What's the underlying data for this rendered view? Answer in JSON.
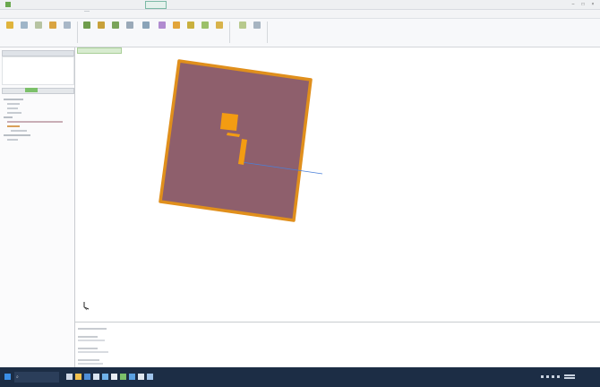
{
  "colors": {
    "substrate_fill": "#8e5f6c",
    "substrate_edge": "#e08f1c",
    "patch": "#f39c12",
    "axis": "#4a7fd8",
    "taskbar": "#1c2d45"
  },
  "icons": {
    "app": "app-logo-icon",
    "ribbon": [
      "toolbar-icon"
    ],
    "taskbar": [
      "windows-start-icon",
      "search-icon",
      "taskbar-app-icon"
    ],
    "viewport_axis": "coordinate-axis-icon"
  },
  "titlebar": {
    "title": ""
  },
  "menubar": {
    "items": [
      "",
      "",
      "",
      "",
      "",
      "",
      "",
      "",
      "",
      "",
      ""
    ]
  },
  "ribbon": {
    "labels": [
      "",
      "",
      "",
      "",
      "",
      "",
      "",
      "",
      "",
      "",
      "",
      "",
      "",
      "",
      "",
      "",
      "",
      "",
      "",
      ""
    ]
  },
  "left_panel": {
    "header_top": "",
    "header_mid": "",
    "tree": [
      "",
      "",
      "",
      "",
      "",
      "",
      "",
      "",
      "",
      ""
    ]
  },
  "viewport": {
    "tab_label": ""
  },
  "console": {
    "lines": [
      "",
      "",
      "",
      "",
      "",
      ""
    ]
  },
  "taskbar": {
    "search_placeholder": "",
    "clock": ""
  }
}
